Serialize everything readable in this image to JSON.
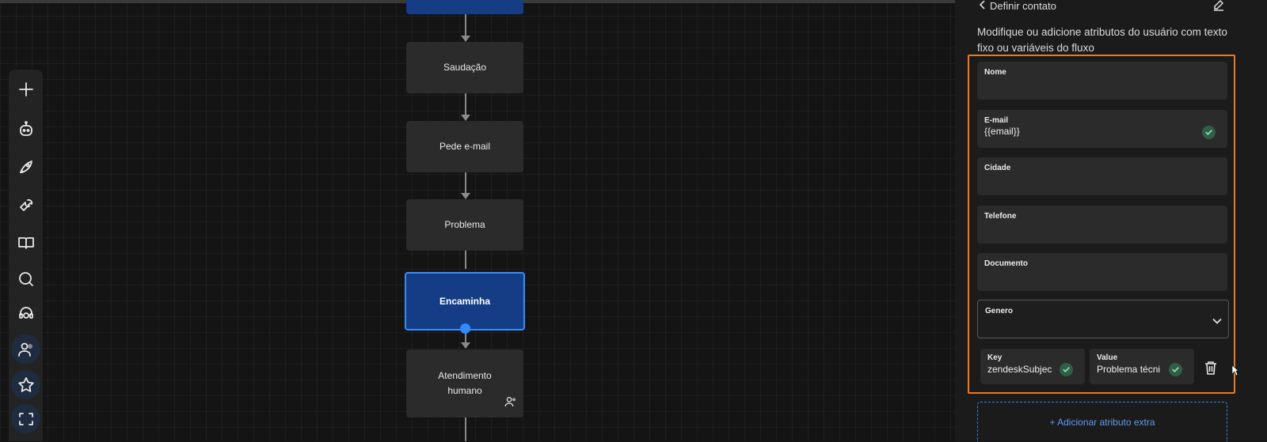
{
  "panel": {
    "title": "Definir contato",
    "description": "Modifique ou adicione atributos do usuário com texto fixo ou variáveis do fluxo",
    "fields": [
      {
        "label": "Nome",
        "value": ""
      },
      {
        "label": "E-mail",
        "value": "{{email}}"
      },
      {
        "label": "Cidade",
        "value": ""
      },
      {
        "label": "Telefone",
        "value": ""
      },
      {
        "label": "Documento",
        "value": ""
      },
      {
        "label": "Genero",
        "value": ""
      }
    ],
    "extra_attribute": {
      "key_label": "Key",
      "key_value": "zendeskSubjec",
      "value_label": "Value",
      "value_value": "Problema técni"
    },
    "add_attribute_label": "+ Adicionar atributo extra"
  },
  "flow": {
    "nodes": [
      {
        "label": "Saudação"
      },
      {
        "label": "Pede e-mail"
      },
      {
        "label": "Problema"
      },
      {
        "label": "Encaminha"
      },
      {
        "label": "Atendimento humano"
      }
    ]
  },
  "toolbar": {
    "icons": [
      "plus-icon",
      "bot-icon",
      "rocket-icon",
      "wrench-icon",
      "book-icon",
      "search-icon",
      "headset-icon",
      "contacts-icon",
      "star-icon",
      "scan-icon"
    ]
  },
  "colors": {
    "canvas_bg": "#141414",
    "node_bg": "#2b2b2b",
    "selected_node": "#153d86",
    "accent_blue": "#2f8cff",
    "highlight_orange": "#e8782a",
    "check_green": "#2f5e48"
  }
}
